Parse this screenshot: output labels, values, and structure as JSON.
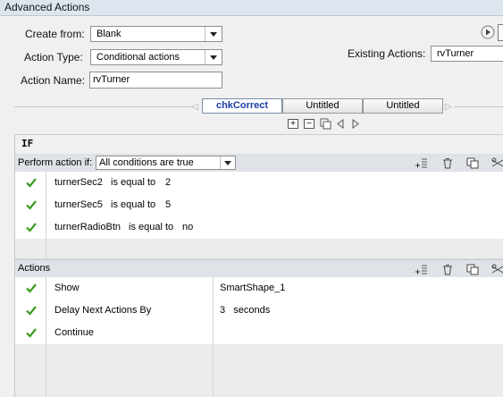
{
  "window": {
    "title": "Advanced Actions"
  },
  "form": {
    "create_from_label": "Create from:",
    "create_from_value": "Blank",
    "action_type_label": "Action Type:",
    "action_type_value": "Conditional actions",
    "action_name_label": "Action Name:",
    "action_name_value": "rvTurner",
    "existing_actions_label": "Existing Actions:",
    "existing_actions_value": "rvTurner"
  },
  "tabs": [
    {
      "label": "chkCorrect",
      "active": true
    },
    {
      "label": "Untitled",
      "active": false
    },
    {
      "label": "Untitled",
      "active": false
    }
  ],
  "if_section": {
    "title": "IF",
    "perform_label": "Perform action if:",
    "perform_value": "All conditions are true",
    "conditions": [
      {
        "variable": "turnerSec2",
        "operator": "is equal to",
        "value": "2"
      },
      {
        "variable": "turnerSec5",
        "operator": "is equal to",
        "value": "5"
      },
      {
        "variable": "turnerRadioBtn",
        "operator": "is equal to",
        "value": "no"
      }
    ]
  },
  "actions_section": {
    "title": "Actions",
    "rows": [
      {
        "action": "Show",
        "target": "SmartShape_1"
      },
      {
        "action": "Delay Next Actions By",
        "target": "3   seconds"
      },
      {
        "action": "Continue",
        "target": ""
      }
    ]
  },
  "icons": {
    "play": "play-icon",
    "add_row": "add-row-icon",
    "delete_row": "delete-row-icon",
    "copy_row": "copy-row-icon",
    "cut_row": "cut-row-icon",
    "check": "check-icon"
  },
  "colors": {
    "check": "#3a9a1f",
    "active_tab_text": "#1a3fa6",
    "header_bg": "#dfe3e7"
  }
}
